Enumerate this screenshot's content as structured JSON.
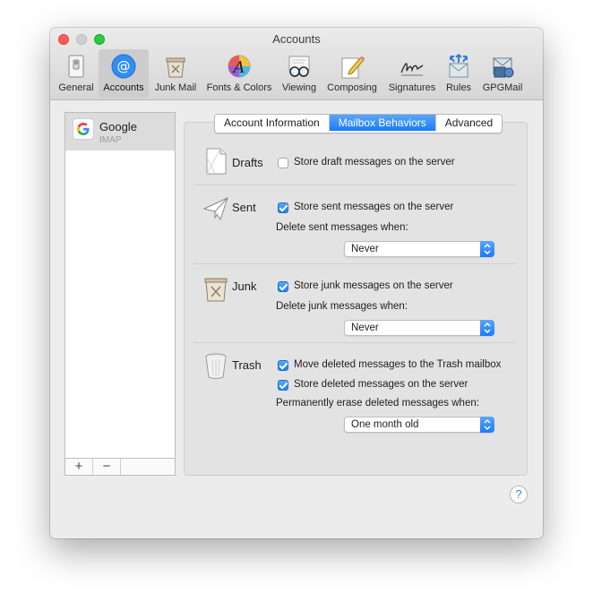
{
  "window": {
    "title": "Accounts"
  },
  "toolbar": {
    "items": [
      {
        "label": "General",
        "icon": "general-switch-icon"
      },
      {
        "label": "Accounts",
        "icon": "at-sign-icon"
      },
      {
        "label": "Junk Mail",
        "icon": "junk-bin-icon"
      },
      {
        "label": "Fonts & Colors",
        "icon": "font-palette-icon"
      },
      {
        "label": "Viewing",
        "icon": "glasses-icon"
      },
      {
        "label": "Composing",
        "icon": "pencil-paper-icon"
      },
      {
        "label": "Signatures",
        "icon": "signature-icon"
      },
      {
        "label": "Rules",
        "icon": "rules-arrows-icon"
      },
      {
        "label": "GPGMail",
        "icon": "gpgmail-icon"
      }
    ],
    "active": "Accounts"
  },
  "sidebar": {
    "accounts": [
      {
        "name": "Google",
        "type": "IMAP"
      }
    ],
    "add_label": "+",
    "remove_label": "−"
  },
  "tabs": {
    "items": [
      "Account Information",
      "Mailbox Behaviors",
      "Advanced"
    ],
    "active": "Mailbox Behaviors"
  },
  "sections": {
    "drafts": {
      "title": "Drafts",
      "store_label": "Store draft messages on the server",
      "store_checked": false
    },
    "sent": {
      "title": "Sent",
      "store_label": "Store sent messages on the server",
      "store_checked": true,
      "delete_label": "Delete sent messages when:",
      "delete_value": "Never"
    },
    "junk": {
      "title": "Junk",
      "store_label": "Store junk messages on the server",
      "store_checked": true,
      "delete_label": "Delete junk messages when:",
      "delete_value": "Never"
    },
    "trash": {
      "title": "Trash",
      "move_label": "Move deleted messages to the Trash mailbox",
      "move_checked": true,
      "store_label": "Store deleted messages on the server",
      "store_checked": true,
      "erase_label": "Permanently erase deleted messages when:",
      "erase_value": "One month old"
    }
  },
  "help": {
    "label": "?"
  },
  "colors": {
    "accent": "#1b7cf4",
    "window_bg": "#ececec",
    "panel_bg": "#e3e3e3"
  }
}
